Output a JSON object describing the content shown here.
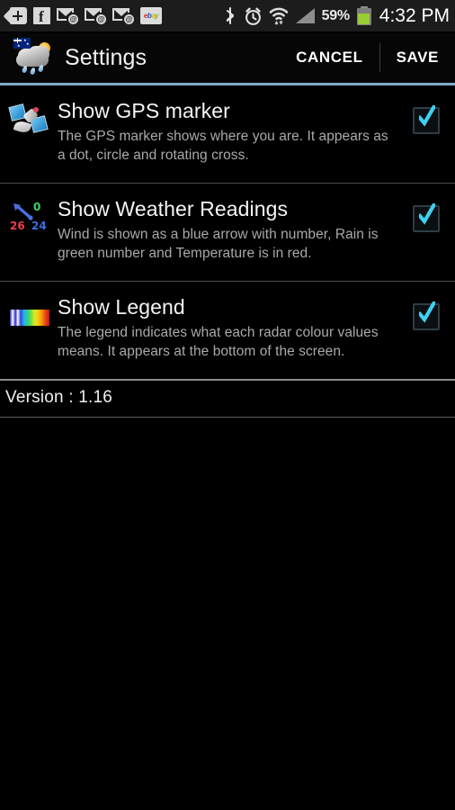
{
  "statusbar": {
    "icons_left": [
      {
        "name": "back-tag-icon",
        "label": "+"
      },
      {
        "name": "facebook-icon",
        "label": "f"
      },
      {
        "name": "email-icon-1",
        "label": "@"
      },
      {
        "name": "email-icon-2",
        "label": "@"
      },
      {
        "name": "email-icon-3",
        "label": "@"
      },
      {
        "name": "ebay-icon",
        "label": "ebay"
      }
    ],
    "ebay_letters": [
      "e",
      "b",
      "a",
      "y"
    ],
    "icons_right": [
      {
        "name": "bluetooth-icon"
      },
      {
        "name": "alarm-icon"
      },
      {
        "name": "wifi-icon"
      },
      {
        "name": "signal-icon"
      }
    ],
    "battery_percent": "59%",
    "time": "4:32 PM",
    "colors": {
      "battery_fill": "#99cc33",
      "icon_gray": "#d8d8d8",
      "bar_background": "#1c1c1c"
    }
  },
  "actionbar": {
    "app_icon_name": "weather-rain-cloud-icon",
    "title": "Settings",
    "cancel_label": "CANCEL",
    "save_label": "SAVE",
    "accent_color": "#7fa9c9"
  },
  "settings": {
    "rows": [
      {
        "icon": "satellite-icon",
        "title": "Show GPS marker",
        "description": "The GPS marker shows where you are. It appears as a dot, circle and rotating cross.",
        "checked": true
      },
      {
        "icon": "weather-readings-icon",
        "title": "Show Weather Readings",
        "description": "Wind is shown as a blue arrow with number, Rain is green number and Temperature is in red.",
        "checked": true
      },
      {
        "icon": "colour-legend-icon",
        "title": "Show Legend",
        "description": "The legend indicates what each radar colour values means. It appears at the bottom of the screen.",
        "checked": true
      }
    ],
    "weather_icon_values": {
      "rain": "0",
      "temperature": "26",
      "wind": "24"
    },
    "checkbox_color": "#3fd0f0"
  },
  "footer": {
    "version_text": "Version : 1.16"
  }
}
